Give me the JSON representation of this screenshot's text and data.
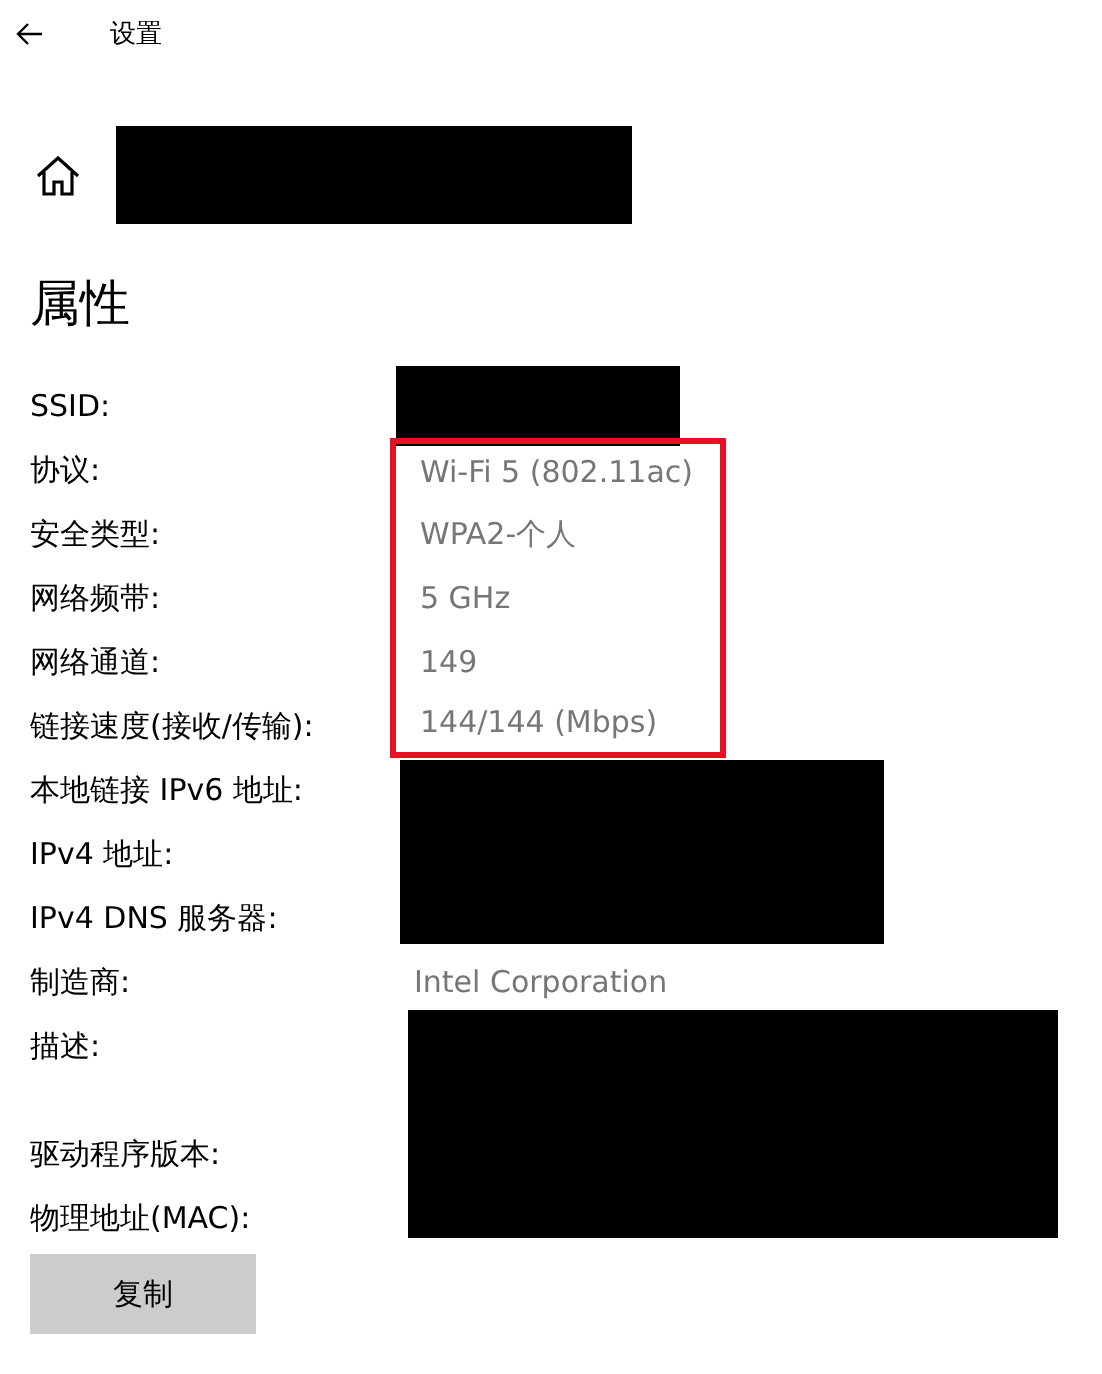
{
  "window": {
    "title": "设置"
  },
  "header": {
    "kind": "redacted"
  },
  "section_title": "属性",
  "properties": [
    {
      "label": "SSID:",
      "kind": "redacted"
    },
    {
      "label": "协议:",
      "kind": "text",
      "value": "Wi-Fi 5 (802.11ac)",
      "highlighted": true
    },
    {
      "label": "安全类型:",
      "kind": "text",
      "value": "WPA2-个人",
      "highlighted": true
    },
    {
      "label": "网络频带:",
      "kind": "text",
      "value": "5 GHz",
      "highlighted": true
    },
    {
      "label": "网络通道:",
      "kind": "text",
      "value": "149",
      "highlighted": true
    },
    {
      "label": "链接速度(接收/传输):",
      "kind": "text",
      "value": "144/144 (Mbps)",
      "highlighted": true
    },
    {
      "label": "本地链接 IPv6 地址:",
      "kind": "redacted"
    },
    {
      "label": "IPv4 地址:",
      "kind": "redacted"
    },
    {
      "label": "IPv4 DNS 服务器:",
      "kind": "redacted"
    },
    {
      "label": "制造商:",
      "kind": "text",
      "value": "Intel Corporation",
      "highlighted": false
    },
    {
      "label": "描述:",
      "kind": "redacted"
    },
    {
      "label": "驱动程序版本:",
      "kind": "redacted"
    },
    {
      "label": "物理地址(MAC):",
      "kind": "redacted"
    }
  ],
  "highlight": {
    "color": "#e81123"
  },
  "buttons": [
    "复制"
  ]
}
